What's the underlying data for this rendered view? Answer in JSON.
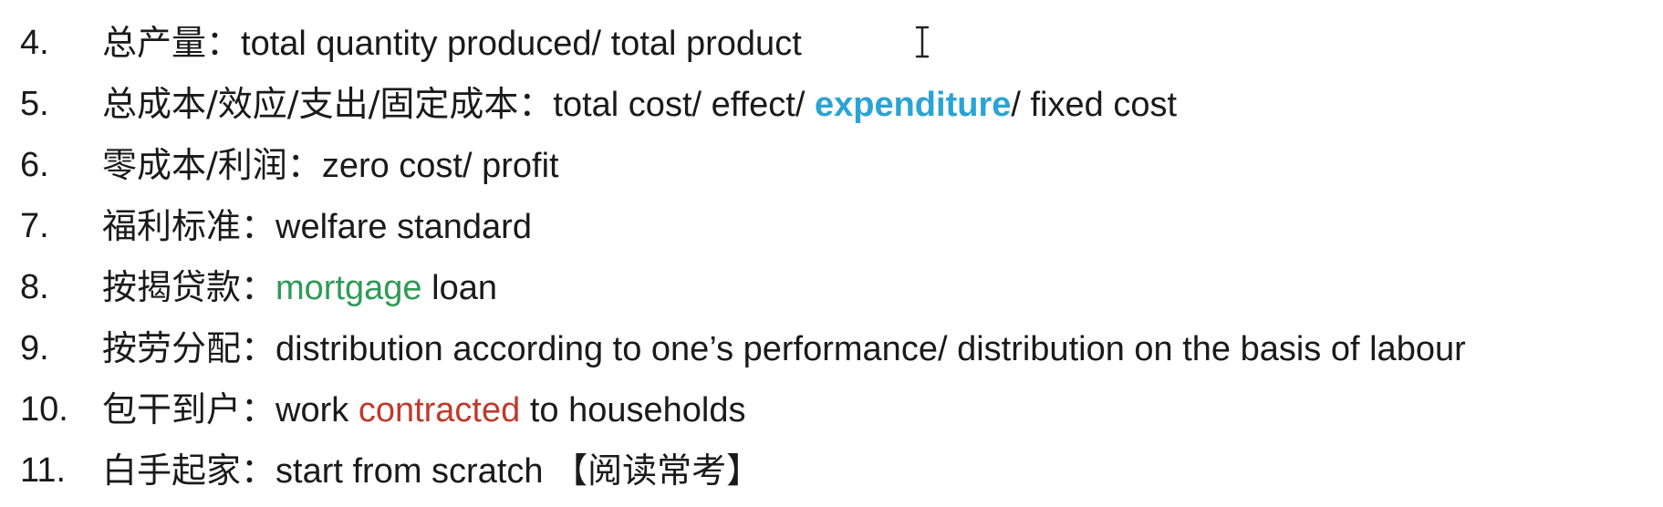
{
  "items": [
    {
      "num": "4.",
      "zh": "总产量：",
      "en": [
        {
          "t": "total quantity produced/ total product",
          "c": ""
        }
      ]
    },
    {
      "num": "5.",
      "zh": "总成本/效应/支出/固定成本：",
      "en": [
        {
          "t": "total cost/ effect/ ",
          "c": ""
        },
        {
          "t": "expenditure",
          "c": "hl-blue"
        },
        {
          "t": "/ fixed cost",
          "c": ""
        }
      ]
    },
    {
      "num": "6.",
      "zh": "零成本/利润：",
      "en": [
        {
          "t": "zero cost/ profit",
          "c": ""
        }
      ]
    },
    {
      "num": "7.",
      "zh": "福利标准：",
      "en": [
        {
          "t": "welfare standard",
          "c": ""
        }
      ]
    },
    {
      "num": "8.",
      "zh": "按揭贷款：",
      "en": [
        {
          "t": "mortgage",
          "c": "hl-green"
        },
        {
          "t": " loan",
          "c": ""
        }
      ]
    },
    {
      "num": "9.",
      "zh": "按劳分配：",
      "en": [
        {
          "t": "distribution according to one’s performance/ distribution on the basis of labour",
          "c": ""
        }
      ]
    },
    {
      "num": "10.",
      "zh": "包干到户：",
      "en": [
        {
          "t": "work ",
          "c": ""
        },
        {
          "t": "contracted",
          "c": "hl-red"
        },
        {
          "t": " to households",
          "c": ""
        }
      ]
    },
    {
      "num": "11.",
      "zh": "白手起家：",
      "en": [
        {
          "t": "start from scratch",
          "c": ""
        },
        {
          "t": "  【阅读常考】",
          "c": "zh"
        }
      ]
    }
  ],
  "colors": {
    "text": "#1a1a1a",
    "highlight_blue": "#2aa3d6",
    "highlight_green": "#2e9a55",
    "highlight_red": "#c0392b"
  },
  "icons": {
    "cursor": "text-cursor-icon"
  }
}
